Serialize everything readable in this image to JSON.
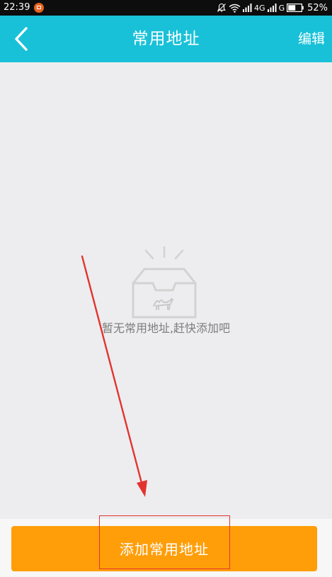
{
  "status_bar": {
    "time": "22:39",
    "network_label": "4G",
    "network_label_2": "G",
    "battery_percent": "52%"
  },
  "header": {
    "title": "常用地址",
    "edit_label": "编辑",
    "background_color": "#18c1d8"
  },
  "empty_state": {
    "message": "暂无常用地址,赶快添加吧",
    "icon": "empty-inbox-camel-icon"
  },
  "footer": {
    "add_button_label": "添加常用地址",
    "button_color": "#ff9e09"
  },
  "annotations": {
    "arrow_color": "#e2342f",
    "highlight_color": "#e2342f"
  }
}
